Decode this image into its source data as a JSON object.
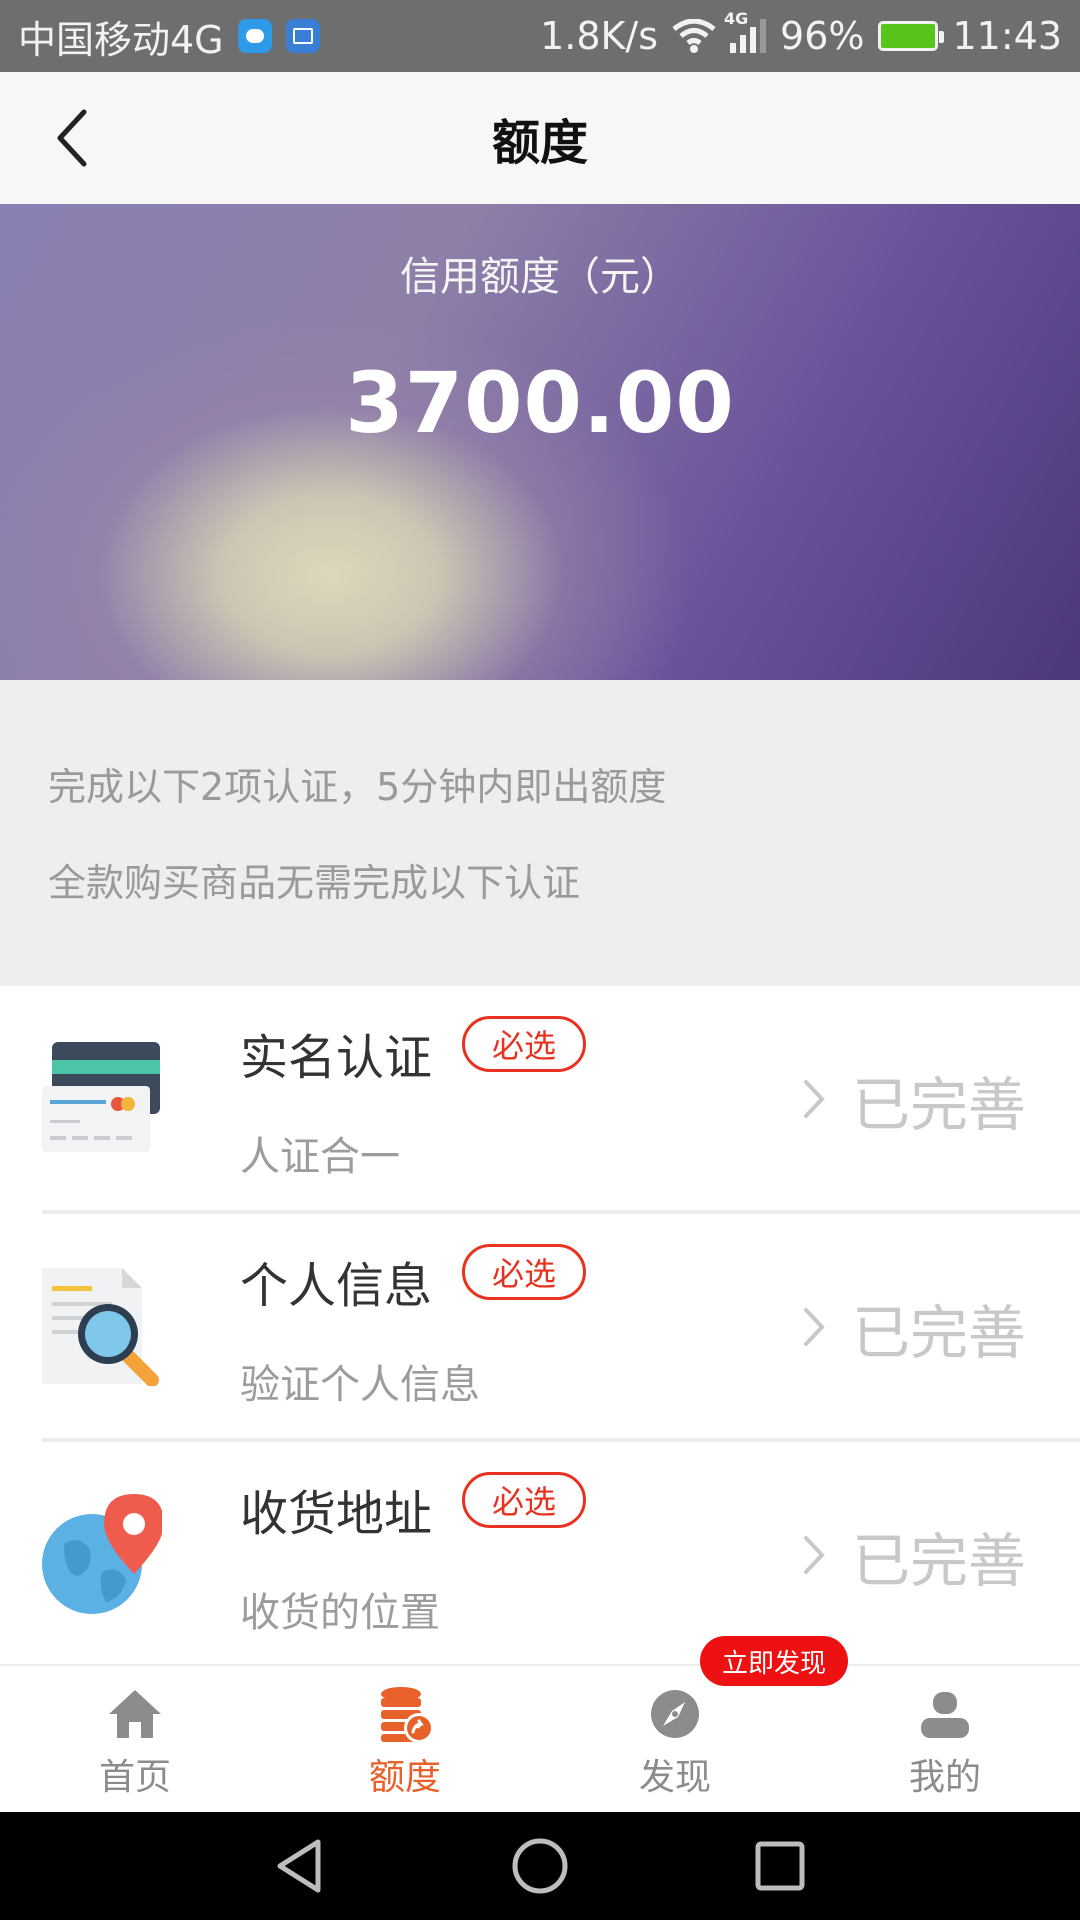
{
  "status_bar": {
    "carrier": "中国移动4G",
    "speed": "1.8K/s",
    "network": "4G",
    "battery": "96%",
    "time": "11:43"
  },
  "header": {
    "title": "额度"
  },
  "hero": {
    "label": "信用额度（元）",
    "amount": "3700.00"
  },
  "notice": {
    "line1": "完成以下2项认证，5分钟内即出额度",
    "line2": "全款购买商品无需完成以下认证"
  },
  "items": [
    {
      "title": "实名认证",
      "badge": "必选",
      "subtitle": "人证合一",
      "status": "已完善",
      "icon": "id-card-icon"
    },
    {
      "title": "个人信息",
      "badge": "必选",
      "subtitle": "验证个人信息",
      "status": "已完善",
      "icon": "document-search-icon"
    },
    {
      "title": "收货地址",
      "badge": "必选",
      "subtitle": "收货的位置",
      "status": "已完善",
      "icon": "globe-pin-icon"
    }
  ],
  "tabbar": {
    "tabs": [
      {
        "label": "首页",
        "icon": "home-icon"
      },
      {
        "label": "额度",
        "icon": "coins-icon",
        "active": true
      },
      {
        "label": "发现",
        "icon": "compass-icon"
      },
      {
        "label": "我的",
        "icon": "user-icon"
      }
    ],
    "discover_badge": "立即发现"
  },
  "colors": {
    "accent": "#e8612a",
    "badge_red": "#e8321f",
    "hero_purple": "#6a529a"
  }
}
